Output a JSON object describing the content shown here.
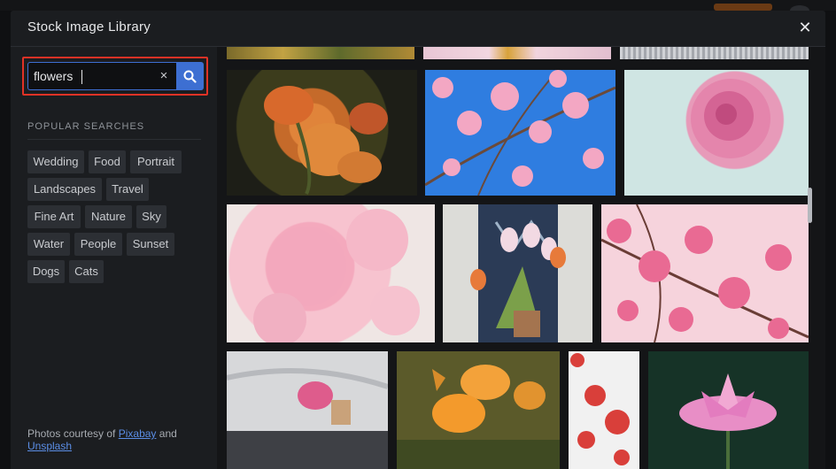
{
  "modal": {
    "title": "Stock Image Library"
  },
  "search": {
    "value": "flowers",
    "clear_icon": "×"
  },
  "popular": {
    "label": "POPULAR SEARCHES",
    "tags": [
      "Wedding",
      "Food",
      "Portrait",
      "Landscapes",
      "Travel",
      "Fine Art",
      "Nature",
      "Sky",
      "Water",
      "People",
      "Sunset",
      "Dogs",
      "Cats"
    ]
  },
  "credit": {
    "prefix": "Photos courtesy of ",
    "link1": "Pixabay",
    "middle": " and ",
    "link2": "Unsplash"
  },
  "close_icon": "✕",
  "colors": {
    "accent": "#3d6fd2",
    "highlight": "#e03226",
    "panel": "#1b1d20",
    "tag_bg": "#2c2f34"
  }
}
